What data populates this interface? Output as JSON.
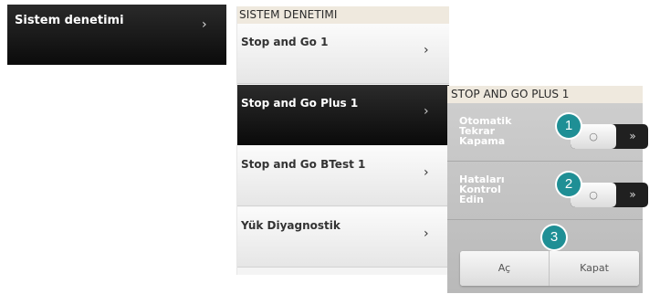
{
  "left_menu": {
    "item_label": "Sistem denetimi",
    "chevron": "›"
  },
  "middle": {
    "header": "SISTEM DENETIMI",
    "items": [
      {
        "label": "Stop and Go 1",
        "chevron": "›"
      },
      {
        "label": "Stop and Go Plus 1",
        "chevron": "›"
      },
      {
        "label": "Stop and Go BTest 1",
        "chevron": "›"
      },
      {
        "label": "Yük Diyagnostik",
        "chevron": "›"
      }
    ]
  },
  "right_panel": {
    "header": "STOP AND GO PLUS 1",
    "settings": [
      {
        "label_lines": [
          "Otomatik",
          "Tekrar",
          "Kapama"
        ],
        "knob": "○",
        "arrow": "»"
      },
      {
        "label_lines": [
          "Hataları",
          "Kontrol",
          "Edin"
        ],
        "knob": "○",
        "arrow": "»"
      }
    ],
    "buttons": {
      "open_label": "Aç",
      "close_label": "Kapat"
    }
  },
  "callouts": [
    "1",
    "2",
    "3"
  ],
  "colors": {
    "badge": "#1f8f95",
    "dark_item": "#111111",
    "panel_header": "#efe9de"
  },
  "icons": {
    "chevron": "chevron-right-icon",
    "knob": "circle-icon",
    "arrow": "double-chevron-right-icon"
  }
}
